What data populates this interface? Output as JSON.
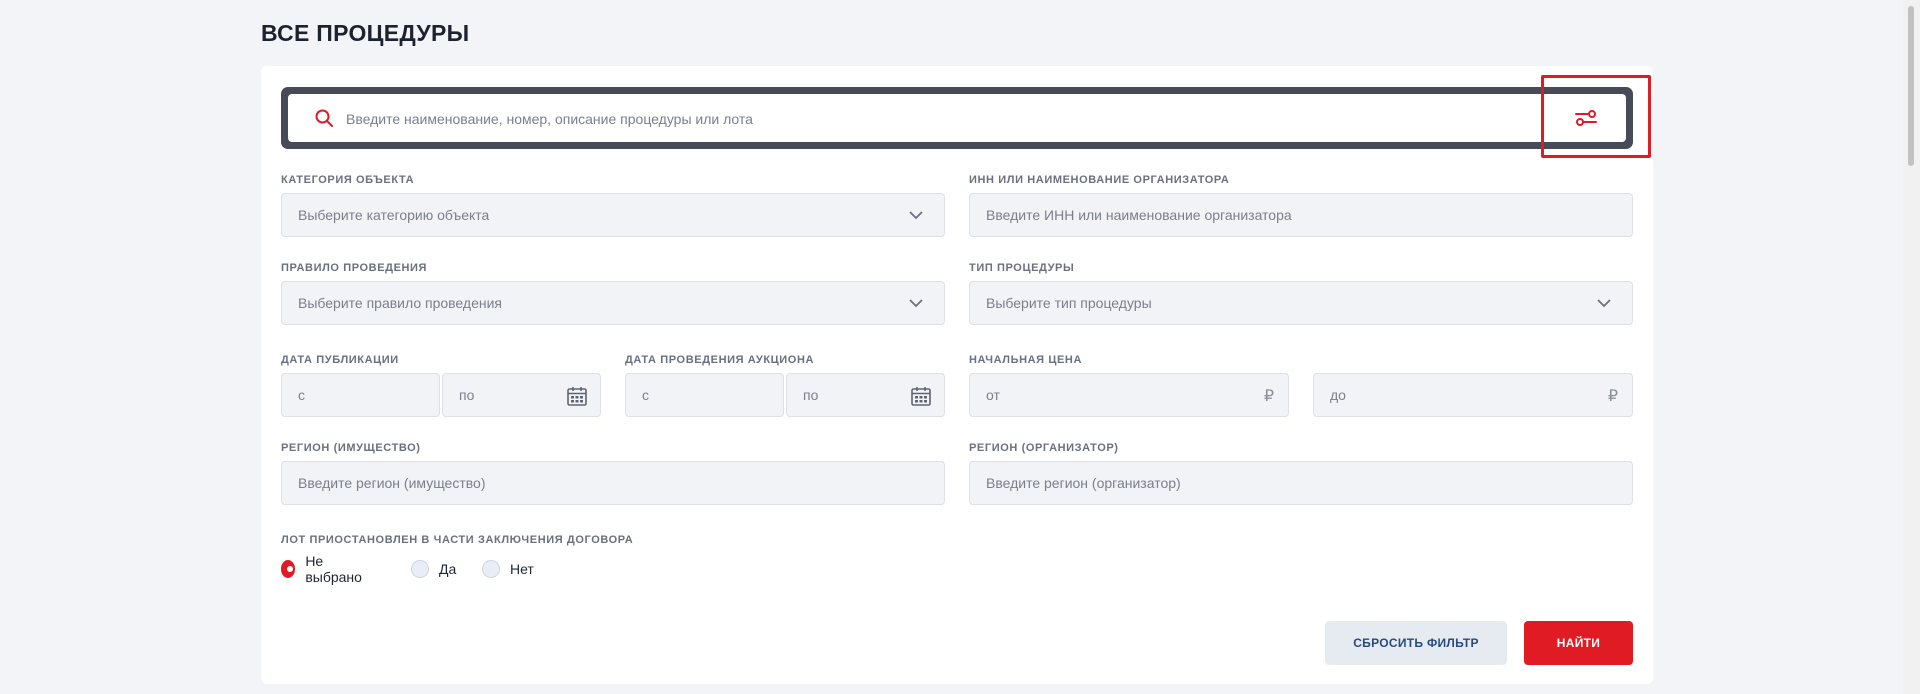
{
  "page": {
    "title": "ВСЕ ПРОЦЕДУРЫ"
  },
  "search": {
    "placeholder": "Введите наименование, номер, описание процедуры или лота",
    "value": ""
  },
  "filters": {
    "category": {
      "label": "КАТЕГОРИЯ ОБЪЕКТА",
      "placeholder": "Выберите категорию объекта"
    },
    "organizer": {
      "label": "ИНН ИЛИ НАИМЕНОВАНИЕ ОРГАНИЗАТОРА",
      "placeholder": "Введите ИНН или наименование организатора"
    },
    "rule": {
      "label": "ПРАВИЛО ПРОВЕДЕНИЯ",
      "placeholder": "Выберите правило проведения"
    },
    "procedure_type": {
      "label": "ТИП ПРОЦЕДУРЫ",
      "placeholder": "Выберите тип процедуры"
    },
    "publication_date": {
      "label": "ДАТА ПУБЛИКАЦИИ",
      "from_placeholder": "с",
      "to_placeholder": "по"
    },
    "auction_date": {
      "label": "ДАТА ПРОВЕДЕНИЯ АУКЦИОНА",
      "from_placeholder": "с",
      "to_placeholder": "по"
    },
    "start_price": {
      "label": "НАЧАЛЬНАЯ ЦЕНА",
      "from_placeholder": "от",
      "to_placeholder": "до",
      "currency": "₽"
    },
    "region_property": {
      "label": "РЕГИОН (ИМУЩЕСТВО)",
      "placeholder": "Введите регион (имущество)"
    },
    "region_organizer": {
      "label": "РЕГИОН (ОРГАНИЗАТОР)",
      "placeholder": "Введите регион (организатор)"
    },
    "lot_suspended": {
      "label": "ЛОТ ПРИОСТАНОВЛЕН В ЧАСТИ ЗАКЛЮЧЕНИЯ ДОГОВОРА",
      "options": [
        "Не выбрано",
        "Да",
        "Нет"
      ],
      "selected": "Не выбрано"
    }
  },
  "buttons": {
    "reset": "СБРОСИТЬ ФИЛЬТР",
    "find": "НАЙТИ"
  },
  "colors": {
    "accent": "#e01b24",
    "search_frame": "#474b58",
    "highlight": "#e01b24"
  },
  "icons": {
    "search": "search-icon",
    "filter": "filter-settings-icon",
    "chevron": "chevron-down-icon",
    "calendar": "calendar-icon"
  }
}
